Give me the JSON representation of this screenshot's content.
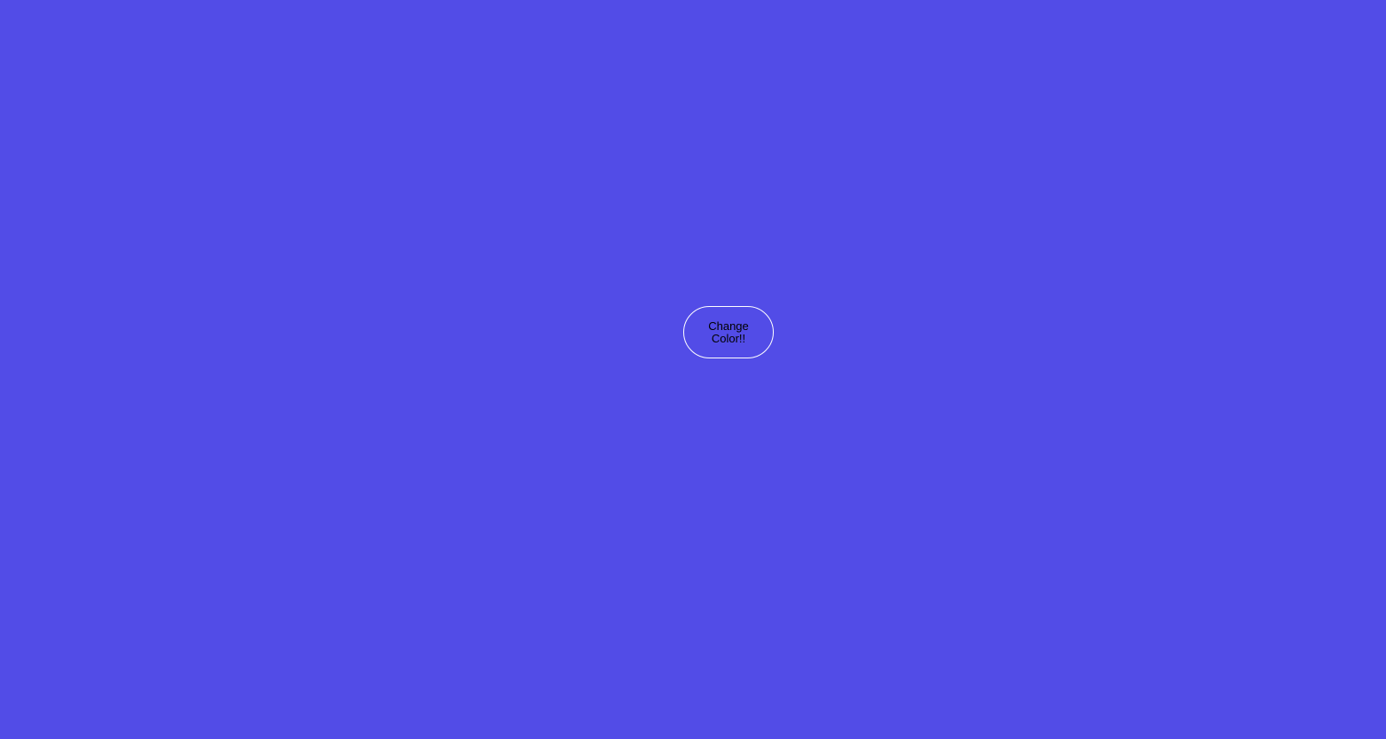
{
  "page": {
    "background_color": "#524ce7"
  },
  "button": {
    "label": "Change Color!!",
    "border_color": "#ffffff",
    "text_color": "#000000"
  }
}
